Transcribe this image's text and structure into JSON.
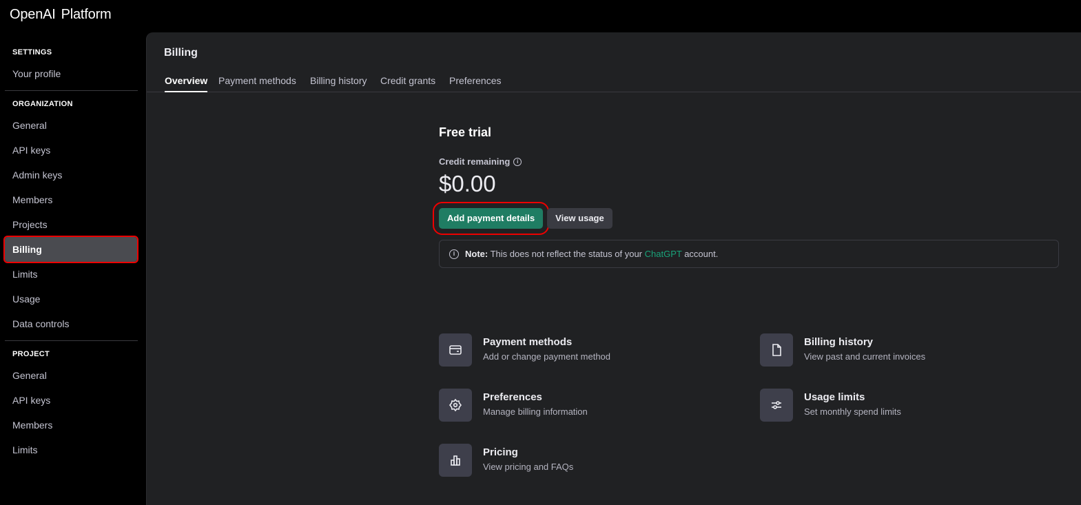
{
  "app": {
    "brand_left": "OpenAI",
    "brand_right": "Platform"
  },
  "sidebar": {
    "settings_label": "SETTINGS",
    "settings_items": [
      {
        "label": "Your profile"
      }
    ],
    "org_label": "ORGANIZATION",
    "org_items": [
      {
        "label": "General"
      },
      {
        "label": "API keys"
      },
      {
        "label": "Admin keys"
      },
      {
        "label": "Members"
      },
      {
        "label": "Projects"
      },
      {
        "label": "Billing"
      },
      {
        "label": "Limits"
      },
      {
        "label": "Usage"
      },
      {
        "label": "Data controls"
      }
    ],
    "project_label": "PROJECT",
    "project_items": [
      {
        "label": "General"
      },
      {
        "label": "API keys"
      },
      {
        "label": "Members"
      },
      {
        "label": "Limits"
      }
    ]
  },
  "page": {
    "title": "Billing",
    "tabs": [
      {
        "label": "Overview"
      },
      {
        "label": "Payment methods"
      },
      {
        "label": "Billing history"
      },
      {
        "label": "Credit grants"
      },
      {
        "label": "Preferences"
      }
    ]
  },
  "overview": {
    "heading": "Free trial",
    "credit_label": "Credit remaining",
    "credit_amount": "$0.00",
    "add_payment": "Add payment details",
    "view_usage": "View usage",
    "note_bold": "Note:",
    "note_text": "This does not reflect the status of your",
    "note_link": "ChatGPT",
    "note_end": "account.",
    "cards": [
      {
        "title": "Payment methods",
        "desc": "Add or change payment method",
        "icon": "credit-card-icon"
      },
      {
        "title": "Billing history",
        "desc": "View past and current invoices",
        "icon": "document-icon"
      },
      {
        "title": "Preferences",
        "desc": "Manage billing information",
        "icon": "gear-icon"
      },
      {
        "title": "Usage limits",
        "desc": "Set monthly spend limits",
        "icon": "sliders-icon"
      },
      {
        "title": "Pricing",
        "desc": "View pricing and FAQs",
        "icon": "bar-chart-icon"
      }
    ]
  },
  "colors": {
    "accent": "#1f7d63",
    "link": "#19a37a",
    "highlight": "#ee0000"
  }
}
